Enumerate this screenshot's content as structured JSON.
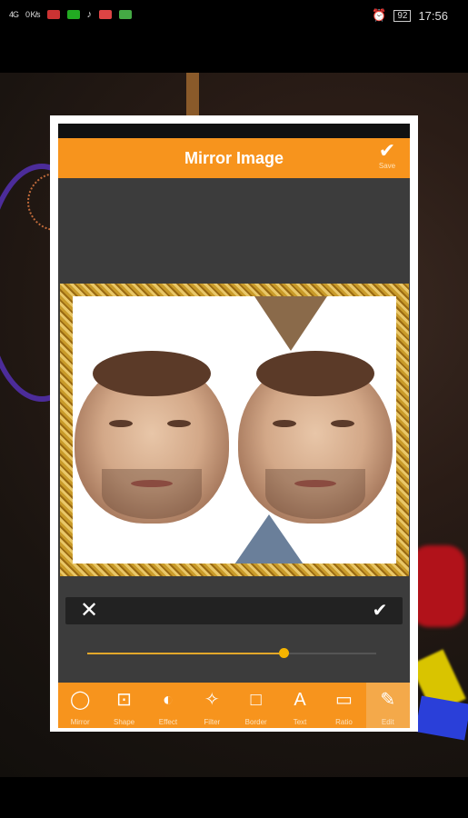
{
  "status_bar": {
    "network": "4G",
    "speed": "0 K/s",
    "battery": "92",
    "time": "17:56"
  },
  "app": {
    "title": "Mirror Image",
    "save_label": "Save"
  },
  "controls": {
    "close_icon": "close-icon",
    "confirm_icon": "check-icon",
    "slider_value": 0.68
  },
  "toolbar": {
    "items": [
      {
        "label": "Mirror",
        "icon": "mirror-icon",
        "glyph": "◯"
      },
      {
        "label": "Shape",
        "icon": "shape-icon",
        "glyph": "⊡"
      },
      {
        "label": "Effect",
        "icon": "effect-icon",
        "glyph": "◐"
      },
      {
        "label": "Filter",
        "icon": "filter-icon",
        "glyph": "✧"
      },
      {
        "label": "Border",
        "icon": "border-icon",
        "glyph": "□"
      },
      {
        "label": "Text",
        "icon": "text-icon",
        "glyph": "A"
      },
      {
        "label": "Ratio",
        "icon": "ratio-icon",
        "glyph": "▭"
      },
      {
        "label": "Edit",
        "icon": "edit-icon",
        "glyph": "✎"
      }
    ],
    "active_index": 7
  },
  "colors": {
    "accent": "#f7941d",
    "slider": "#f5b400"
  }
}
